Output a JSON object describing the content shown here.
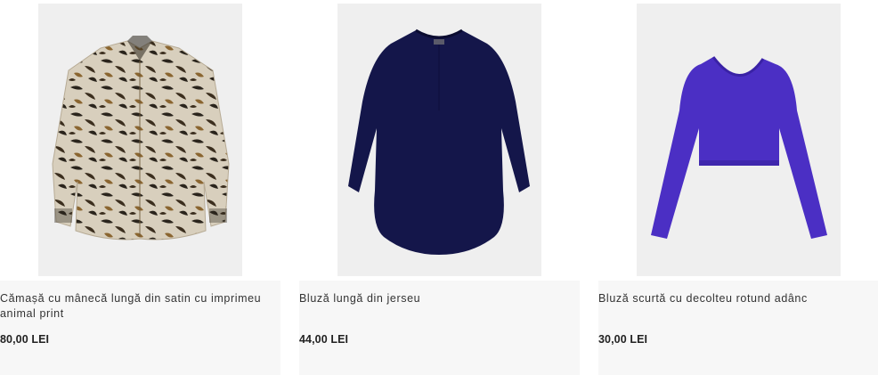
{
  "products": [
    {
      "name": "Cămașă cu mânecă lungă din satin cu imprimeu animal print",
      "price": "80,00 LEI",
      "image": "leopard-print-satin-shirt"
    },
    {
      "name": "Bluză lungă din jerseu",
      "price": "44,00 LEI",
      "image": "navy-long-jersey-blouse"
    },
    {
      "name": "Bluză scurtă cu decolteu rotund adânc",
      "price": "30,00 LEI",
      "image": "purple-cropped-top"
    }
  ],
  "colors": {
    "navy": "#14164a",
    "purple": "#4b2fc4",
    "leopard_base": "#ddd4c4"
  }
}
